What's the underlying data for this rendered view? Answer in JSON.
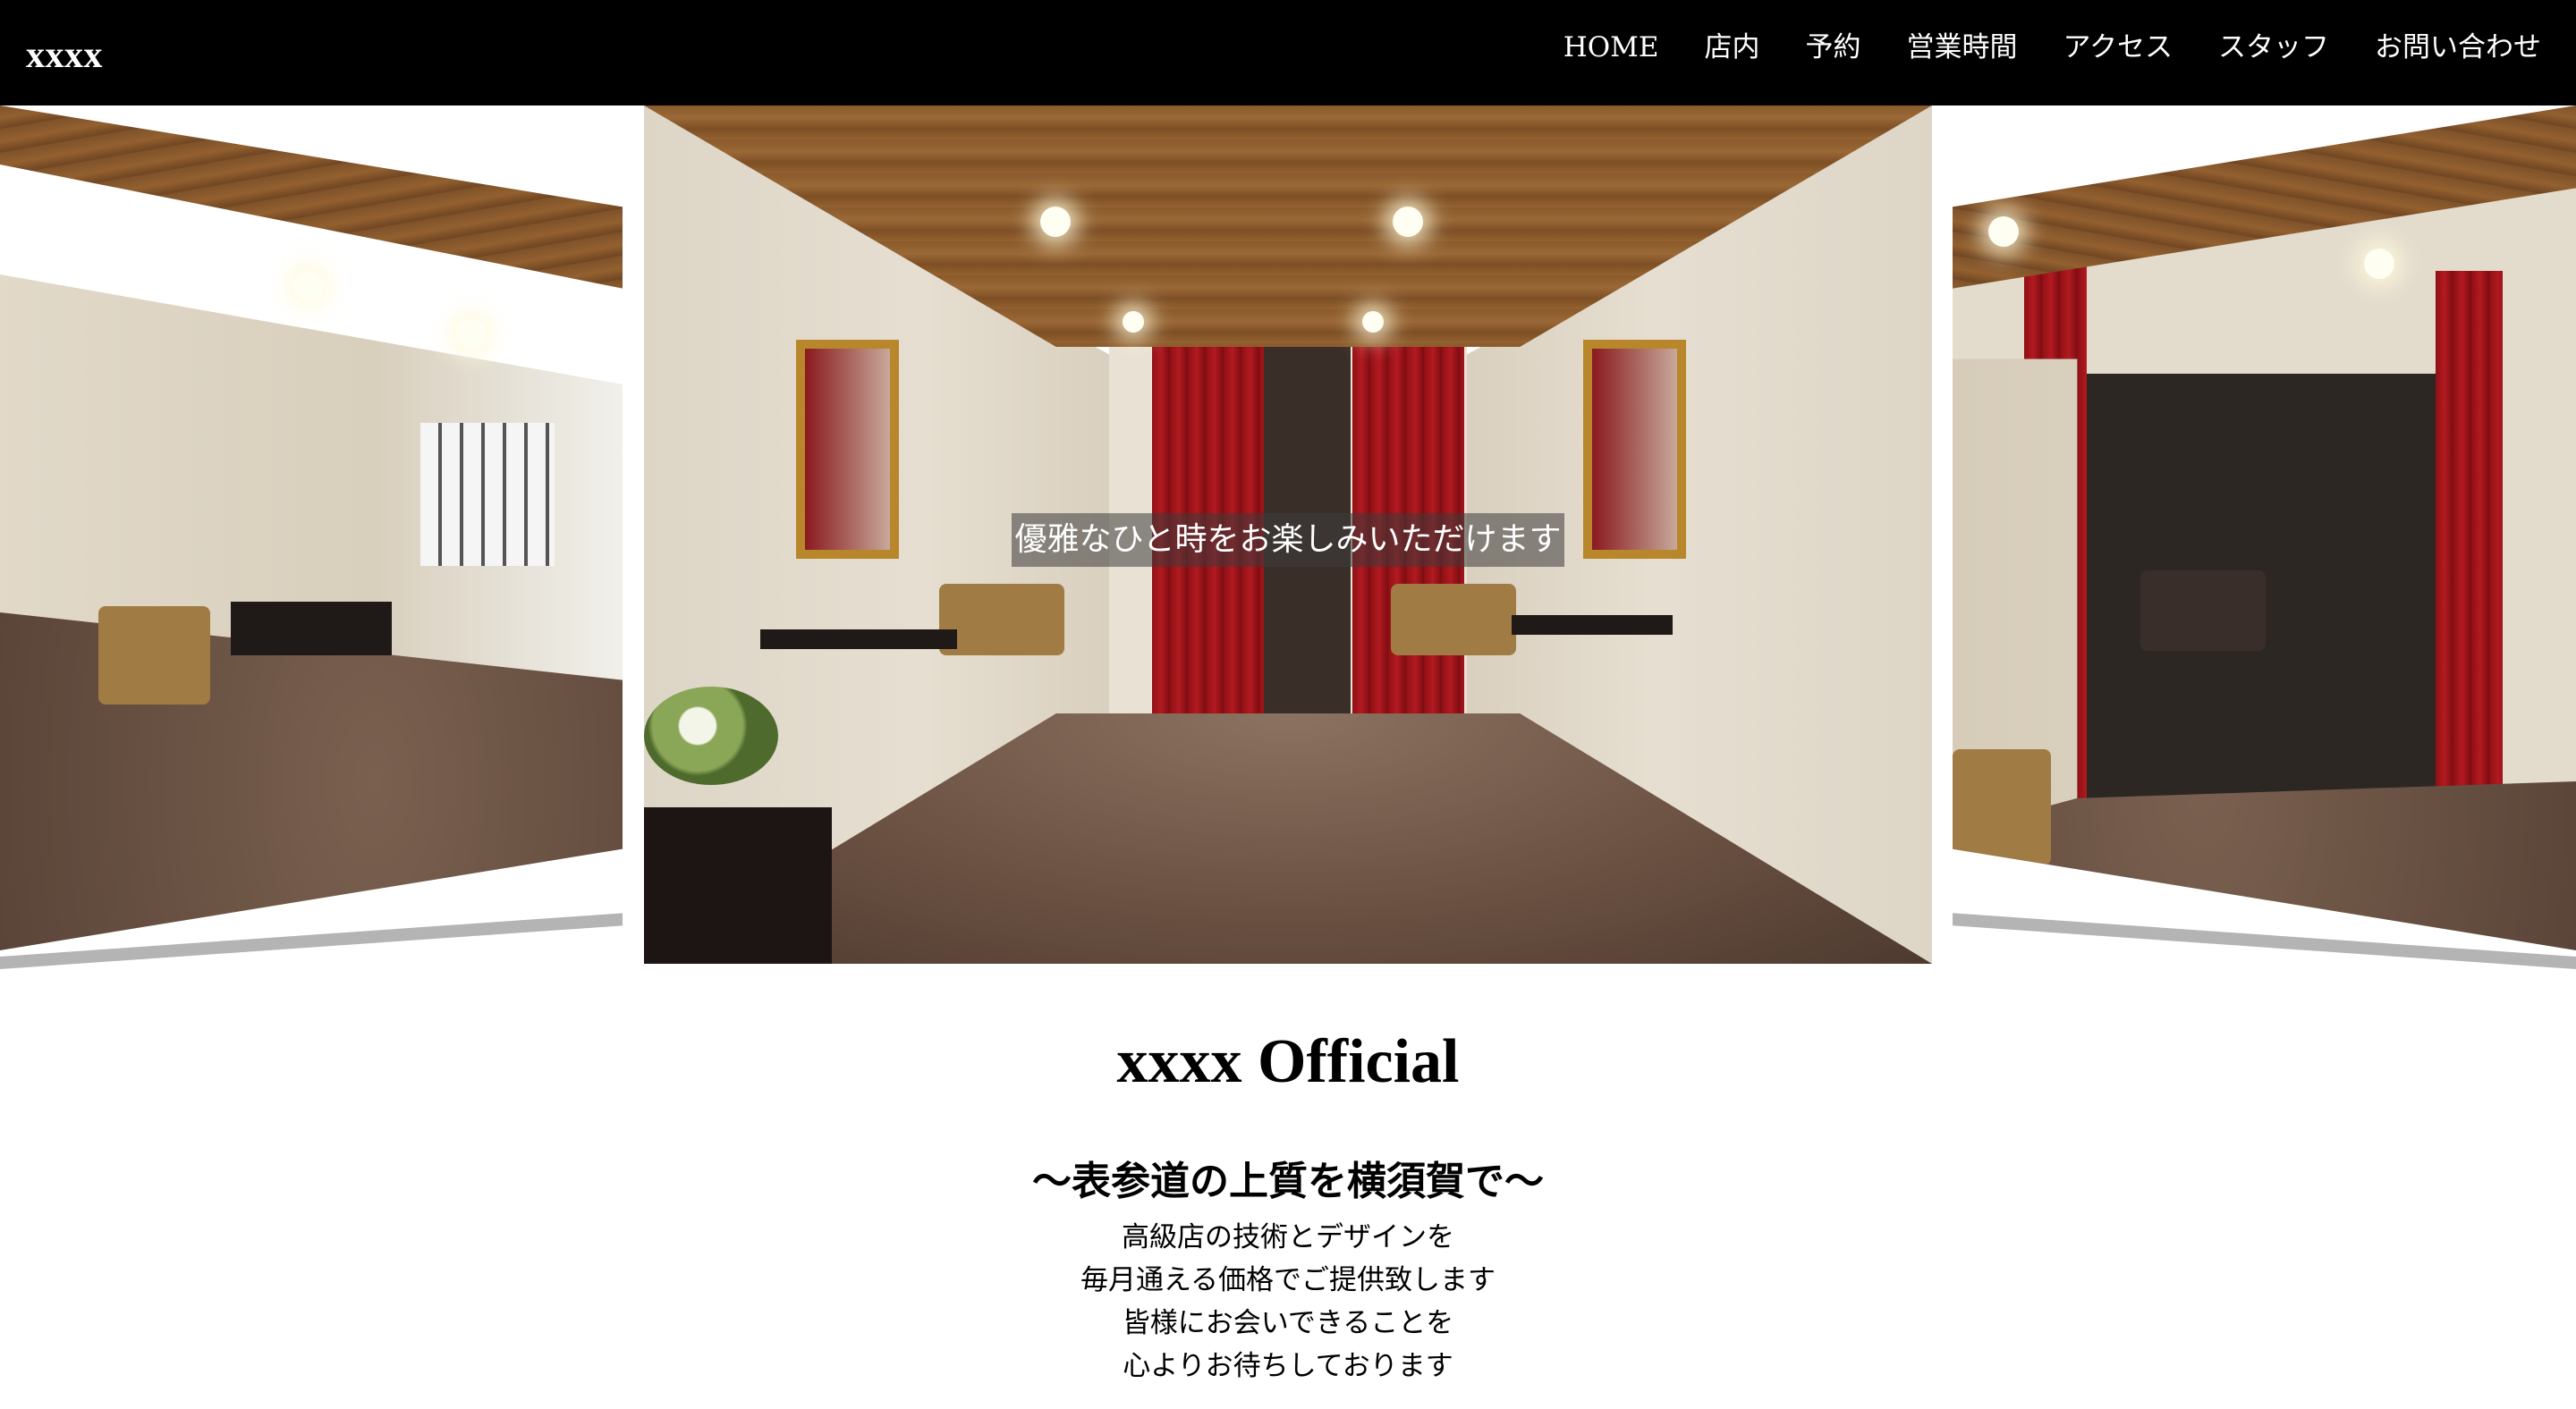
{
  "header": {
    "brand": "xxxx",
    "nav": [
      {
        "label": "HOME"
      },
      {
        "label": "店内"
      },
      {
        "label": "予約"
      },
      {
        "label": "営業時間"
      },
      {
        "label": "アクセス"
      },
      {
        "label": "スタッフ"
      },
      {
        "label": "お問い合わせ"
      }
    ],
    "background": "#000000",
    "text_color": "#ffffff"
  },
  "hero": {
    "caption": "優雅なひと時をお楽しみいただけます",
    "slides": [
      "salon-waiting-area-left",
      "salon-lounge-center",
      "salon-treatment-room-right"
    ]
  },
  "content": {
    "title": "xxxx Official",
    "subtitle": "〜表参道の上質を横須賀で〜",
    "lines": [
      "高級店の技術とデザインを",
      "毎月通える価格でご提供致します",
      "皆様にお会いできることを",
      "心よりお待ちしております"
    ]
  }
}
